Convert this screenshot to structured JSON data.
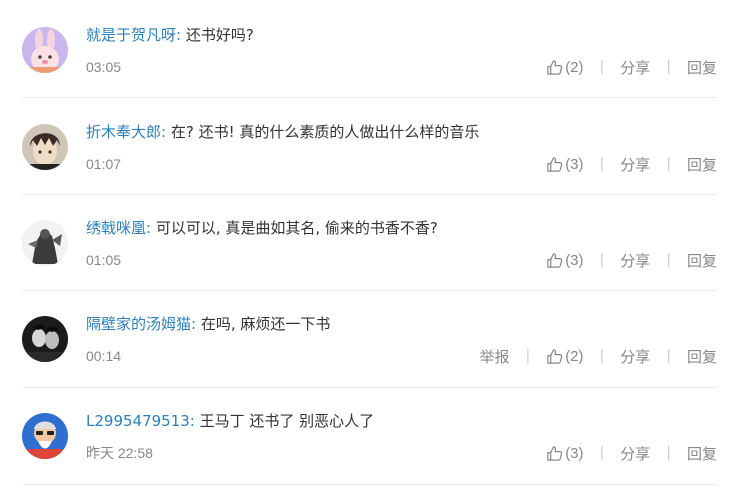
{
  "colors": {
    "username": "#2e7fb8",
    "content": "#333333",
    "meta": "#888888",
    "separator": "#cccccc",
    "divider": "#ececec"
  },
  "actions": {
    "share_label": "分享",
    "reply_label": "回复",
    "report_label": "举报"
  },
  "comments": [
    {
      "username": "就是于贺凡呀",
      "colon": ":",
      "text": " 还书好吗?",
      "time": "03:05",
      "likes": "(2)",
      "avatar": "pink-rabbit-avatar"
    },
    {
      "username": "折木奉大郎",
      "colon": ":",
      "text": " 在? 还书! 真的什么素质的人做出什么样的音乐",
      "time": "01:07",
      "likes": "(3)",
      "avatar": "anime-boy-avatar"
    },
    {
      "username": "绣戟咪凰",
      "colon": ":",
      "text": " 可以可以, 真是曲如其名, 偷来的书香不香?",
      "time": "01:05",
      "likes": "(3)",
      "avatar": "dark-figure-avatar"
    },
    {
      "username": "隔壁家的汤姆猫",
      "colon": ":",
      "text": " 在吗, 麻烦还一下书",
      "time": "00:14",
      "likes": "(2)",
      "avatar": "dark-portrait-avatar",
      "has_report": true
    },
    {
      "username": "L2995479513",
      "colon": ":",
      "text": " 王马丁 还书了 别恶心人了",
      "time": "昨天 22:58",
      "likes": "(3)",
      "avatar": "colorful-character-avatar"
    }
  ]
}
